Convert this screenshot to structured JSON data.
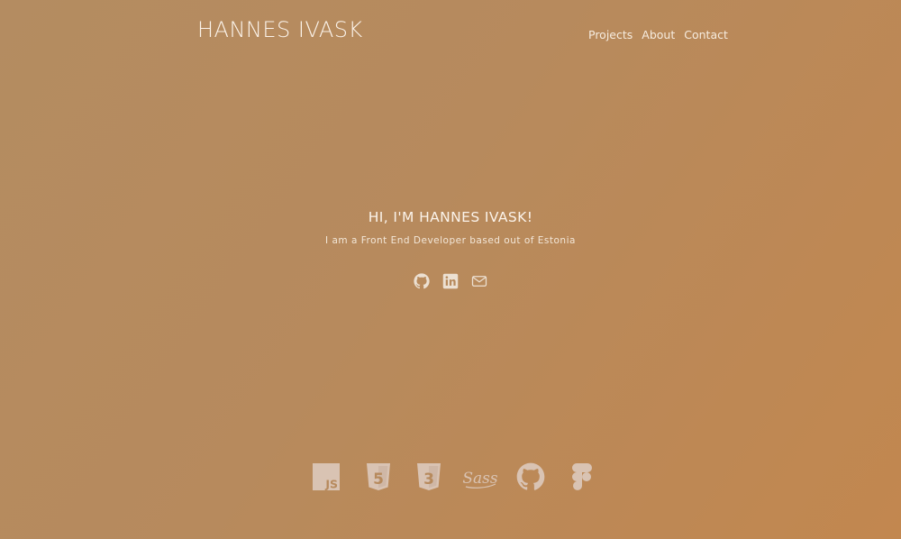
{
  "header": {
    "logo": "HANNES IVASK",
    "nav": [
      {
        "label": "Projects"
      },
      {
        "label": "About"
      },
      {
        "label": "Contact"
      }
    ]
  },
  "hero": {
    "title": "HI, I'M HANNES IVASK!",
    "subtitle": "I am a Front End Developer based out of Estonia"
  },
  "social_links": [
    {
      "icon": "github-icon"
    },
    {
      "icon": "linkedin-icon"
    },
    {
      "icon": "mail-icon"
    }
  ],
  "tech_stack": [
    {
      "icon": "javascript-icon",
      "label": "JS"
    },
    {
      "icon": "html5-icon",
      "label": "5"
    },
    {
      "icon": "css3-icon",
      "label": "3"
    },
    {
      "icon": "sass-icon",
      "label": "Sass"
    },
    {
      "icon": "github-icon"
    },
    {
      "icon": "figma-icon"
    }
  ],
  "colors": {
    "background_start": "#b48c61",
    "background_end": "#c2874f",
    "text": "#fbf3ea",
    "tech_icon": "#d9c3b3"
  }
}
